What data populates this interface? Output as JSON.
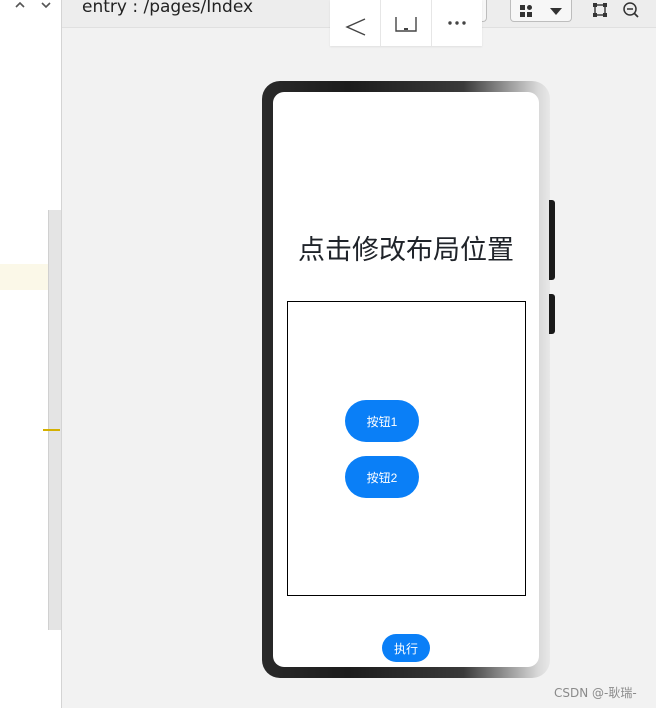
{
  "editor": {
    "title": "entry : /pages/Index",
    "nav_up_icon": "chevron-up-icon",
    "nav_down_icon": "chevron-down-icon"
  },
  "toolbar": {
    "icons": [
      "eye-inspect-icon",
      "layers-icon",
      "component-grid-icon",
      "dropdown-arrow-icon",
      "crop-frame-icon",
      "zoom-out-icon"
    ],
    "device_icons": [
      "back-triangle-icon",
      "home-square-icon",
      "more-dots-icon"
    ],
    "active_color": "#2d7be0"
  },
  "app": {
    "heading": "点击修改布局位置",
    "button1_label": "按钮1",
    "button2_label": "按钮2",
    "execute_label": "执行",
    "accent_color": "#0a7ff7"
  },
  "watermark": "CSDN @-耿瑞-"
}
